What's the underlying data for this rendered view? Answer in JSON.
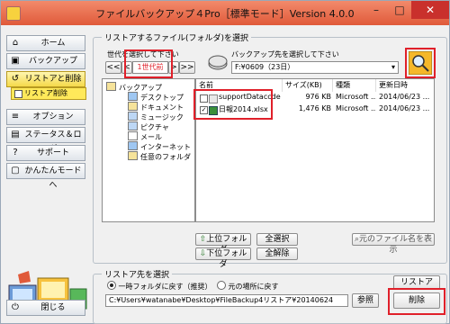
{
  "window": {
    "title": "ファイルバックアップ４Pro［標準モード］Version 4.0.0",
    "controls": {
      "minimize": "–",
      "maximize": "□",
      "close": "✕"
    }
  },
  "sidebar": {
    "items": [
      {
        "label": "ホーム",
        "icon": "home-icon",
        "glyph": "⌂"
      },
      {
        "label": "バックアップ",
        "icon": "backup-icon",
        "glyph": "▣"
      },
      {
        "label": "リストアと削除",
        "icon": "restore-icon",
        "glyph": "↺"
      },
      {
        "label": "リストア削除",
        "icon": "restore-delete-icon"
      },
      {
        "label": "オプション",
        "icon": "options-icon",
        "glyph": "≡"
      },
      {
        "label": "ステータス＆ログ",
        "icon": "status-log-icon",
        "glyph": "▤"
      },
      {
        "label": "サポート",
        "icon": "support-icon",
        "glyph": "?"
      },
      {
        "label": "かんたんモードへ",
        "icon": "easy-mode-icon",
        "glyph": "▢"
      },
      {
        "label": "閉じる",
        "icon": "close-door-icon",
        "glyph": "⏻"
      }
    ]
  },
  "file_section": {
    "heading": "リストアするファイル(フォルダ)を選択",
    "generation_label": "世代を選択して下さい",
    "generation_first": "<<",
    "generation_prev": "<",
    "generation_value": "1世代前",
    "generation_next": ">",
    "generation_last": ">>",
    "backup_dest_label": "バックアップ先を選択して下さい",
    "backup_dest_value": "F:¥0609（23日）"
  },
  "tree": {
    "root": "バックアップ",
    "items": [
      "デスクトップ",
      "ドキュメント",
      "ミュージック",
      "ピクチャ",
      "メール",
      "インターネット",
      "任意のフォルダ"
    ]
  },
  "file_list": {
    "columns": [
      "名前",
      "サイズ(KB)",
      "種類",
      "更新日時"
    ],
    "rows": [
      {
        "checked": false,
        "name": "supportDataccde",
        "size": "976 KB",
        "type": "Microsoft ...",
        "date": "2014/06/23 ..."
      },
      {
        "checked": true,
        "name": "日報2014.xlsx",
        "size": "1,476 KB",
        "type": "Microsoft ...",
        "date": "2014/06/23 ..."
      }
    ]
  },
  "actions": {
    "up_folder": "上位フォルダ",
    "down_folder": "下位フォルダ",
    "select_all": "全選択",
    "deselect_all": "全解除",
    "restore_name": "元のファイル名を表示"
  },
  "restore_section": {
    "heading": "リストア先を選択",
    "option_temp": "一時フォルダに戻す（推奨）",
    "option_original": "元の場所に戻す",
    "path_value": "C:¥Users¥watanabe¥Desktop¥FileBackup4リストア¥20140624",
    "browse": "参照",
    "restore_button": "リストア",
    "delete_button": "削除"
  },
  "colors": {
    "accent_red": "#e0202a",
    "titlebar": "#e86a4a",
    "highlight_yellow": "#f5d94a"
  }
}
